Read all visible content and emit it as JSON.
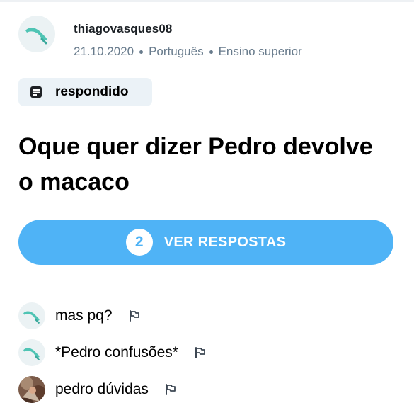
{
  "colors": {
    "accent": "#4fb3f6",
    "badge_bg": "#ebf2f7",
    "muted_text": "#687b8c"
  },
  "question": {
    "author": "thiagovasques08",
    "date": "21.10.2020",
    "subject": "Português",
    "level": "Ensino superior",
    "status_icon": "document-icon",
    "status": "respondido",
    "title": "Oque quer dizer Pedro devolve o macaco"
  },
  "answers_button": {
    "count": "2",
    "label": "VER RESPOSTAS"
  },
  "comments": [
    {
      "text": "mas pq?",
      "avatar": "default-avatar",
      "flag_icon": "flag-icon"
    },
    {
      "text": "*Pedro confusões*",
      "avatar": "default-avatar",
      "flag_icon": "flag-icon"
    },
    {
      "text": "pedro dúvidas",
      "avatar": "photo-avatar",
      "flag_icon": "flag-icon"
    }
  ]
}
